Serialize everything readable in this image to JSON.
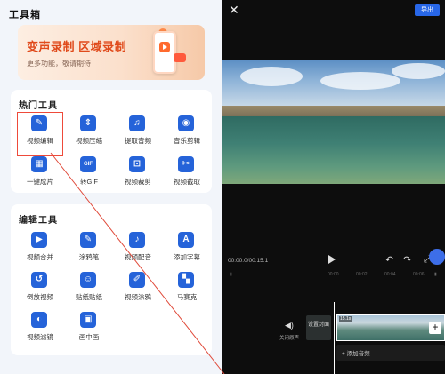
{
  "left": {
    "title": "工具箱",
    "banner": {
      "title": "变声录制 区域录制",
      "subtitle": "更多功能，敬请期待"
    },
    "hot_tools": {
      "heading": "热门工具",
      "items": [
        {
          "label": "视频编辑",
          "icon": "edit-icon",
          "glyph": "✎"
        },
        {
          "label": "视频压缩",
          "icon": "compress-icon",
          "glyph": "⇕"
        },
        {
          "label": "提取音频",
          "icon": "headphones-icon",
          "glyph": "♫"
        },
        {
          "label": "音乐剪辑",
          "icon": "music-disc-icon",
          "glyph": "◉"
        },
        {
          "label": "一键成片",
          "icon": "film-icon",
          "glyph": "▦"
        },
        {
          "label": "转GIF",
          "icon": "gif-icon",
          "glyph": "GIF"
        },
        {
          "label": "视频裁剪",
          "icon": "crop-icon",
          "glyph": "⊡"
        },
        {
          "label": "视频截取",
          "icon": "scissors-icon",
          "glyph": "✂"
        }
      ]
    },
    "edit_tools": {
      "heading": "编辑工具",
      "items": [
        {
          "label": "视频合并",
          "icon": "play-icon",
          "glyph": "▶"
        },
        {
          "label": "涂鸦笔",
          "icon": "pen-icon",
          "glyph": "✎"
        },
        {
          "label": "视频配音",
          "icon": "microphone-icon",
          "glyph": "♪"
        },
        {
          "label": "添加字幕",
          "icon": "text-icon",
          "glyph": "A"
        },
        {
          "label": "倒放视频",
          "icon": "reverse-icon",
          "glyph": "↺"
        },
        {
          "label": "贴纸贴纸",
          "icon": "sticker-icon",
          "glyph": "☺"
        },
        {
          "label": "视频涂鸦",
          "icon": "brush-icon",
          "glyph": "✐"
        },
        {
          "label": "马赛克",
          "icon": "mosaic-icon",
          "glyph": "▚"
        },
        {
          "label": "视频滤镜",
          "icon": "filter-icon",
          "glyph": "◐"
        },
        {
          "label": "画中画",
          "icon": "pip-icon",
          "glyph": "▣"
        }
      ]
    }
  },
  "right": {
    "export_label": "导出",
    "time": "00:00.0/00:15.1",
    "ruler": [
      "00:00",
      "00:02",
      "00:04",
      "00:06"
    ],
    "sound_label": "关闭原声",
    "cover_label": "设置封面",
    "track_time": "15.1s",
    "add_audio_label": "+ 添加音频"
  }
}
